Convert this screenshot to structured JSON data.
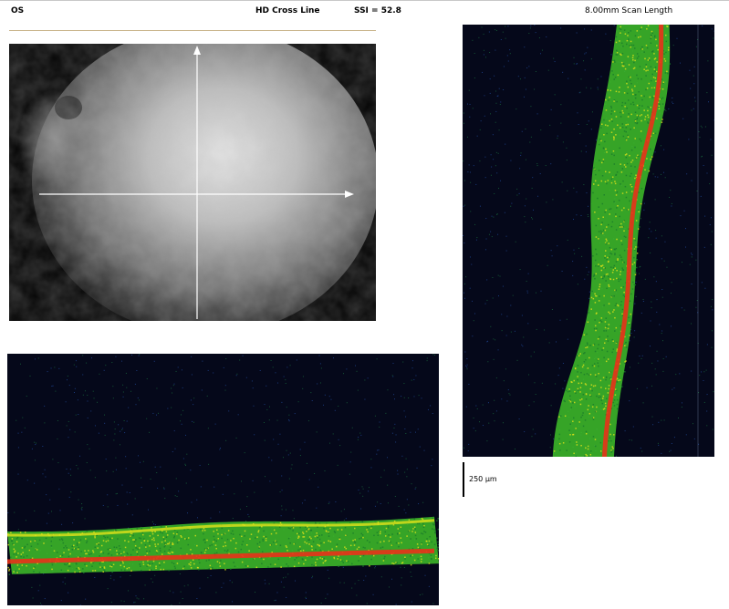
{
  "header": {
    "eye": "OS",
    "scan_type": "HD Cross Line",
    "ssi": "SSI = 52.8",
    "scan_length": "8.00mm Scan Length"
  },
  "scale_bar": {
    "label": "250 µm"
  },
  "colors": {
    "oct_background": "#05081a",
    "oct_green": "#3fbf2a",
    "oct_yellow": "#e2e21a",
    "oct_red": "#e8321a",
    "fundus_frame": "#c9b48a"
  },
  "icons": {
    "fundus_vertical_arrow": "arrow-up-icon",
    "fundus_horizontal_arrow": "arrow-right-icon"
  }
}
